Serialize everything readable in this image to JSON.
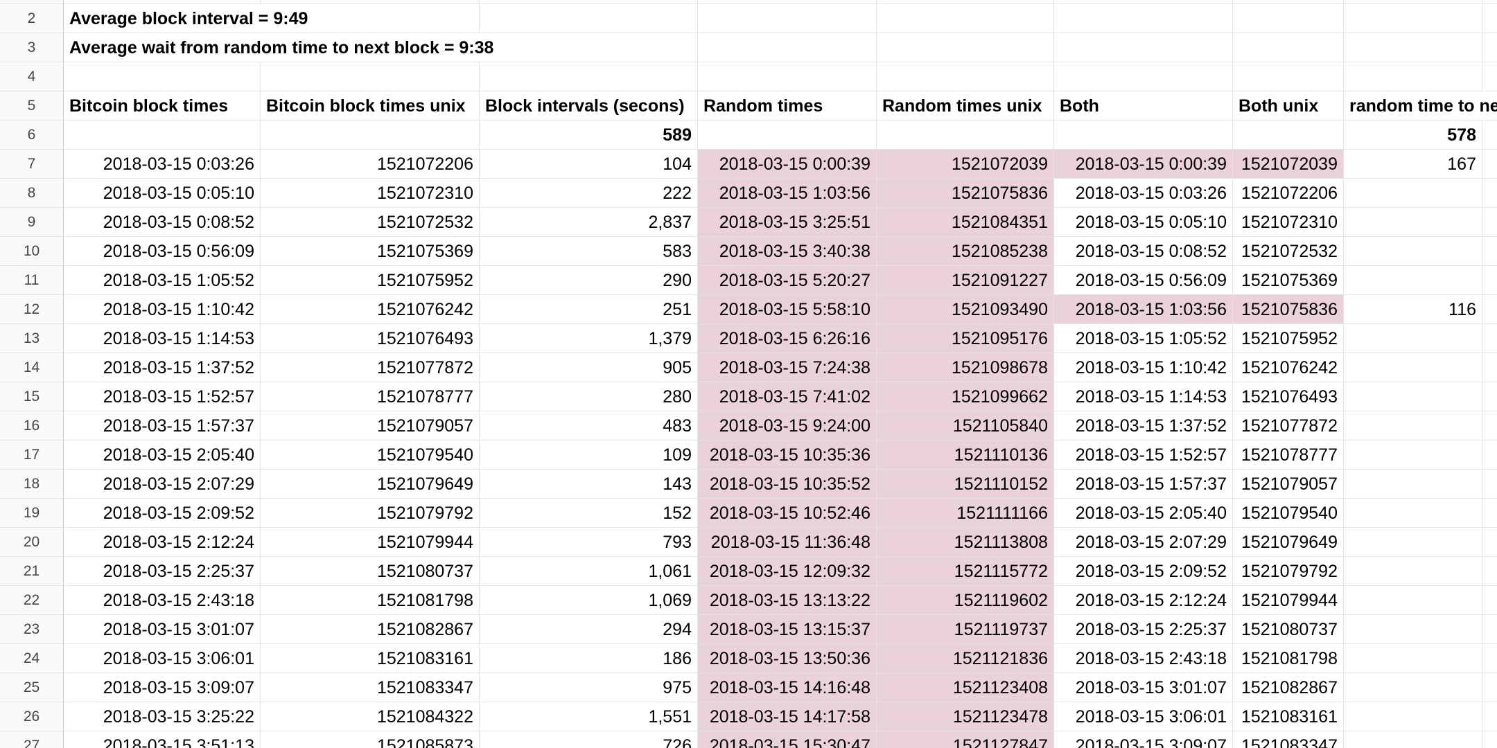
{
  "summary": {
    "row2": {
      "num": "2",
      "text": "Average block interval = 9:49"
    },
    "row3": {
      "num": "3",
      "text": "Average wait from random time to next block = 9:38"
    },
    "row4": {
      "num": "4"
    }
  },
  "headers": {
    "num": "5",
    "cols": [
      "Bitcoin block times",
      "Bitcoin block times unix",
      "Block intervals (secons)",
      "Random times",
      "Random times unix",
      "Both",
      "Both unix",
      "random time to ne"
    ]
  },
  "averages": {
    "num": "6",
    "block_interval_avg": "589",
    "random_wait_avg": "578"
  },
  "rows": [
    {
      "num": "7",
      "bt": "2018-03-15 0:03:26",
      "btu": "1521072206",
      "iv": "104",
      "rt": "2018-03-15 0:00:39",
      "rtu": "1521072039",
      "b": "2018-03-15 0:00:39",
      "bu": "1521072039",
      "w": "167",
      "hl": true
    },
    {
      "num": "8",
      "bt": "2018-03-15 0:05:10",
      "btu": "1521072310",
      "iv": "222",
      "rt": "2018-03-15 1:03:56",
      "rtu": "1521075836",
      "b": "2018-03-15 0:03:26",
      "bu": "1521072206",
      "w": "",
      "hl": false
    },
    {
      "num": "9",
      "bt": "2018-03-15 0:08:52",
      "btu": "1521072532",
      "iv": "2,837",
      "rt": "2018-03-15 3:25:51",
      "rtu": "1521084351",
      "b": "2018-03-15 0:05:10",
      "bu": "1521072310",
      "w": "",
      "hl": false
    },
    {
      "num": "10",
      "bt": "2018-03-15 0:56:09",
      "btu": "1521075369",
      "iv": "583",
      "rt": "2018-03-15 3:40:38",
      "rtu": "1521085238",
      "b": "2018-03-15 0:08:52",
      "bu": "1521072532",
      "w": "",
      "hl": false
    },
    {
      "num": "11",
      "bt": "2018-03-15 1:05:52",
      "btu": "1521075952",
      "iv": "290",
      "rt": "2018-03-15 5:20:27",
      "rtu": "1521091227",
      "b": "2018-03-15 0:56:09",
      "bu": "1521075369",
      "w": "",
      "hl": false
    },
    {
      "num": "12",
      "bt": "2018-03-15 1:10:42",
      "btu": "1521076242",
      "iv": "251",
      "rt": "2018-03-15 5:58:10",
      "rtu": "1521093490",
      "b": "2018-03-15 1:03:56",
      "bu": "1521075836",
      "w": "116",
      "hl": true
    },
    {
      "num": "13",
      "bt": "2018-03-15 1:14:53",
      "btu": "1521076493",
      "iv": "1,379",
      "rt": "2018-03-15 6:26:16",
      "rtu": "1521095176",
      "b": "2018-03-15 1:05:52",
      "bu": "1521075952",
      "w": "",
      "hl": false
    },
    {
      "num": "14",
      "bt": "2018-03-15 1:37:52",
      "btu": "1521077872",
      "iv": "905",
      "rt": "2018-03-15 7:24:38",
      "rtu": "1521098678",
      "b": "2018-03-15 1:10:42",
      "bu": "1521076242",
      "w": "",
      "hl": false
    },
    {
      "num": "15",
      "bt": "2018-03-15 1:52:57",
      "btu": "1521078777",
      "iv": "280",
      "rt": "2018-03-15 7:41:02",
      "rtu": "1521099662",
      "b": "2018-03-15 1:14:53",
      "bu": "1521076493",
      "w": "",
      "hl": false
    },
    {
      "num": "16",
      "bt": "2018-03-15 1:57:37",
      "btu": "1521079057",
      "iv": "483",
      "rt": "2018-03-15 9:24:00",
      "rtu": "1521105840",
      "b": "2018-03-15 1:37:52",
      "bu": "1521077872",
      "w": "",
      "hl": false
    },
    {
      "num": "17",
      "bt": "2018-03-15 2:05:40",
      "btu": "1521079540",
      "iv": "109",
      "rt": "2018-03-15 10:35:36",
      "rtu": "1521110136",
      "b": "2018-03-15 1:52:57",
      "bu": "1521078777",
      "w": "",
      "hl": false
    },
    {
      "num": "18",
      "bt": "2018-03-15 2:07:29",
      "btu": "1521079649",
      "iv": "143",
      "rt": "2018-03-15 10:35:52",
      "rtu": "1521110152",
      "b": "2018-03-15 1:57:37",
      "bu": "1521079057",
      "w": "",
      "hl": false
    },
    {
      "num": "19",
      "bt": "2018-03-15 2:09:52",
      "btu": "1521079792",
      "iv": "152",
      "rt": "2018-03-15 10:52:46",
      "rtu": "1521111166",
      "b": "2018-03-15 2:05:40",
      "bu": "1521079540",
      "w": "",
      "hl": false
    },
    {
      "num": "20",
      "bt": "2018-03-15 2:12:24",
      "btu": "1521079944",
      "iv": "793",
      "rt": "2018-03-15 11:36:48",
      "rtu": "1521113808",
      "b": "2018-03-15 2:07:29",
      "bu": "1521079649",
      "w": "",
      "hl": false
    },
    {
      "num": "21",
      "bt": "2018-03-15 2:25:37",
      "btu": "1521080737",
      "iv": "1,061",
      "rt": "2018-03-15 12:09:32",
      "rtu": "1521115772",
      "b": "2018-03-15 2:09:52",
      "bu": "1521079792",
      "w": "",
      "hl": false
    },
    {
      "num": "22",
      "bt": "2018-03-15 2:43:18",
      "btu": "1521081798",
      "iv": "1,069",
      "rt": "2018-03-15 13:13:22",
      "rtu": "1521119602",
      "b": "2018-03-15 2:12:24",
      "bu": "1521079944",
      "w": "",
      "hl": false
    },
    {
      "num": "23",
      "bt": "2018-03-15 3:01:07",
      "btu": "1521082867",
      "iv": "294",
      "rt": "2018-03-15 13:15:37",
      "rtu": "1521119737",
      "b": "2018-03-15 2:25:37",
      "bu": "1521080737",
      "w": "",
      "hl": false
    },
    {
      "num": "24",
      "bt": "2018-03-15 3:06:01",
      "btu": "1521083161",
      "iv": "186",
      "rt": "2018-03-15 13:50:36",
      "rtu": "1521121836",
      "b": "2018-03-15 2:43:18",
      "bu": "1521081798",
      "w": "",
      "hl": false
    },
    {
      "num": "25",
      "bt": "2018-03-15 3:09:07",
      "btu": "1521083347",
      "iv": "975",
      "rt": "2018-03-15 14:16:48",
      "rtu": "1521123408",
      "b": "2018-03-15 3:01:07",
      "bu": "1521082867",
      "w": "",
      "hl": false
    },
    {
      "num": "26",
      "bt": "2018-03-15 3:25:22",
      "btu": "1521084322",
      "iv": "1,551",
      "rt": "2018-03-15 14:17:58",
      "rtu": "1521123478",
      "b": "2018-03-15 3:06:01",
      "bu": "1521083161",
      "w": "",
      "hl": false
    },
    {
      "num": "27",
      "bt": "2018-03-15 3:51:13",
      "btu": "1521085873",
      "iv": "726",
      "rt": "2018-03-15 15:30:47",
      "rtu": "1521127847",
      "b": "2018-03-15 3:09:07",
      "bu": "1521083347",
      "w": "",
      "hl": false
    }
  ],
  "colors": {
    "highlight": "#ead1dc",
    "gridline": "#e2e3e3",
    "header_bg": "#f8f9fa"
  }
}
